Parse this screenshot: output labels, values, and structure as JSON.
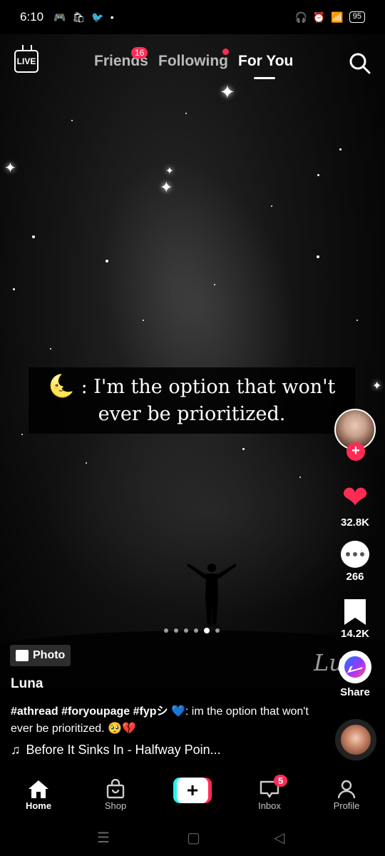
{
  "status_bar": {
    "time": "6:10",
    "battery": "95"
  },
  "top_nav": {
    "live_label": "LIVE",
    "tabs": [
      {
        "label": "Friends",
        "badge": "16"
      },
      {
        "label": "Following"
      },
      {
        "label": "For You",
        "selected": true
      }
    ]
  },
  "post": {
    "quote_line_1": ": I'm the option that won't",
    "quote_line_2": "ever be prioritized.",
    "type_chip": "Photo",
    "username": "Luna",
    "hashtags": "#athread #foryoupage  #fypシ 💙",
    "caption_text": ": im the option that won't ever be prioritized. 🥺💔",
    "music": "Before It Sinks In - Halfway Poin...",
    "carousel": {
      "count": 6,
      "active_index": 4
    }
  },
  "actions": {
    "likes": "32.8K",
    "comments": "266",
    "saves": "14.2K",
    "share_label": "Share"
  },
  "tab_bar": {
    "home": "Home",
    "shop": "Shop",
    "inbox": "Inbox",
    "inbox_badge": "5",
    "profile": "Profile"
  },
  "colors": {
    "accent": "#fe2c55",
    "cyan": "#25f4ee"
  }
}
